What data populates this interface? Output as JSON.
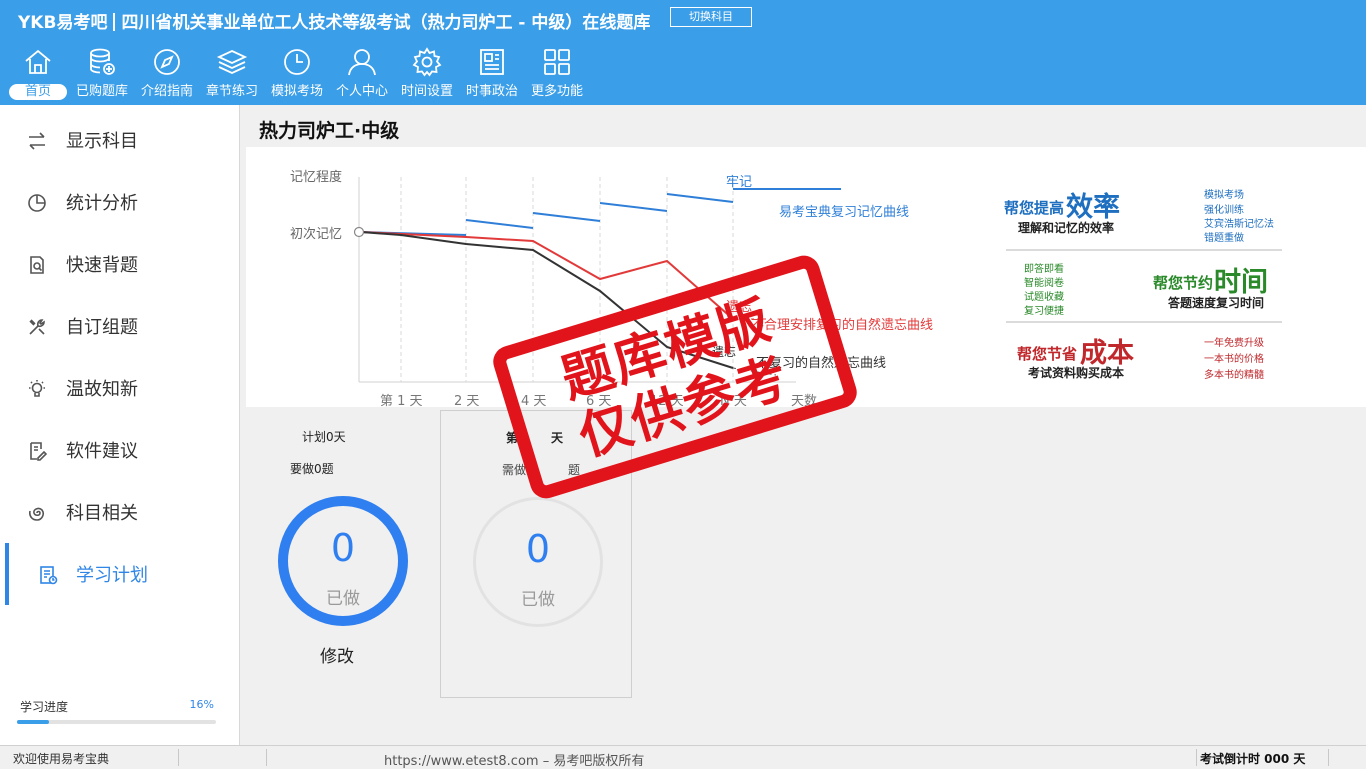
{
  "header": {
    "logo": "YKB易考吧",
    "title": "四川省机关事业单位工人技术等级考试（热力司炉工 - 中级）在线题库",
    "switch_label": "切换科目"
  },
  "nav": [
    {
      "label": "首页",
      "icon": "home-icon"
    },
    {
      "label": "已购题库",
      "icon": "database-add-icon"
    },
    {
      "label": "介绍指南",
      "icon": "compass-icon"
    },
    {
      "label": "章节练习",
      "icon": "layers-icon"
    },
    {
      "label": "模拟考场",
      "icon": "clock-icon"
    },
    {
      "label": "个人中心",
      "icon": "user-icon"
    },
    {
      "label": "时间设置",
      "icon": "gear-icon"
    },
    {
      "label": "时事政治",
      "icon": "newspaper-icon"
    },
    {
      "label": "更多功能",
      "icon": "grid-icon"
    }
  ],
  "sidebar": {
    "items": [
      {
        "label": "显示科目",
        "icon": "swap-arrows-icon"
      },
      {
        "label": "统计分析",
        "icon": "pie-chart-icon"
      },
      {
        "label": "快速背题",
        "icon": "document-search-icon"
      },
      {
        "label": "自订组题",
        "icon": "tools-icon"
      },
      {
        "label": "温故知新",
        "icon": "lightbulb-icon"
      },
      {
        "label": "软件建议",
        "icon": "edit-document-icon"
      },
      {
        "label": "科目相关",
        "icon": "spiral-icon"
      },
      {
        "label": "学习计划",
        "icon": "calendar-plan-icon"
      }
    ],
    "progress_label": "学习进度",
    "progress_pct": "16%",
    "progress_value": 16
  },
  "main": {
    "title": "热力司炉工·中级"
  },
  "banner": {
    "memory_label": "记忆程度",
    "initial_label": "初次记忆",
    "x_ticks": [
      "第 1 天",
      "2 天",
      "4 天",
      "6 天",
      "12 天",
      "N 天",
      "天数"
    ],
    "laoji": "牢记",
    "ykb_curve": "易考宝典复习记忆曲线",
    "yiwang1": "遗忘",
    "reasonable_curve": "不合理安排复习的自然遗忘曲线",
    "yiwang2": "遗忘",
    "no_review_curve": "不复习的自然遗忘曲线",
    "promo1_head": "帮您提高",
    "promo1_big": "效率",
    "promo1_sub": "理解和记忆的效率",
    "promo1_list": [
      "模拟考场",
      "强化训练",
      "艾宾浩斯记忆法",
      "错题重做"
    ],
    "promo2_list": [
      "即答即看",
      "智能阅卷",
      "试题收藏",
      "复习便捷"
    ],
    "promo2_head": "帮您节约",
    "promo2_big": "时间",
    "promo2_sub": "答题速度复习时间",
    "promo3_head": "帮您节省",
    "promo3_big": "成本",
    "promo3_sub": "考试资料购买成本",
    "promo3_list": [
      "一年免费升级",
      "一本书的价格",
      "多本书的精髓"
    ]
  },
  "card1": {
    "plan": "计划0天",
    "todo": "要做0题",
    "done_num": "0",
    "done_label": "已做",
    "modify": "修改"
  },
  "card2": {
    "day_prefix": "第",
    "day_suffix": "天",
    "need_prefix": "需做",
    "need_suffix": "题",
    "done_num": "0",
    "done_label": "已做"
  },
  "watermark": {
    "line1": "题库模版",
    "line2": "仅供参考"
  },
  "status": {
    "welcome": "欢迎使用易考宝典",
    "copyright": "https://www.etest8.com – 易考吧版权所有",
    "countdown": "考试倒计时 000 天"
  },
  "colors": {
    "brand_blue": "#3a9ee8",
    "accent_blue": "#2f86e6",
    "stamp_red": "#e2141b"
  }
}
